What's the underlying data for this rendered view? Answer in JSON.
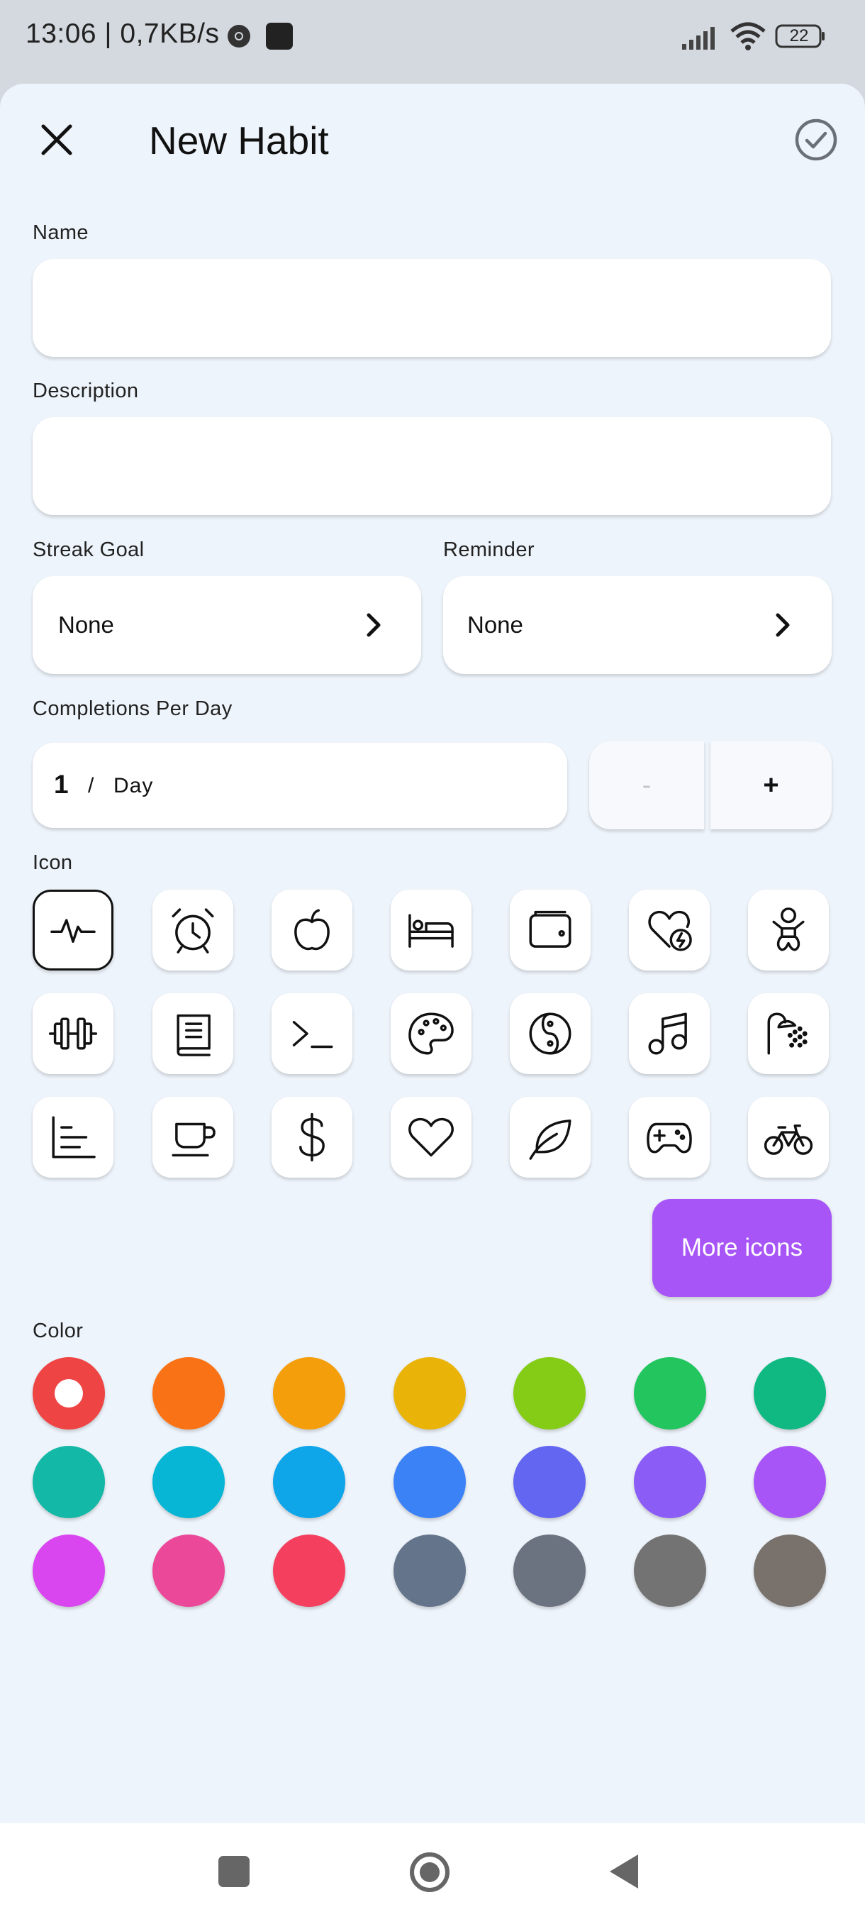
{
  "status_bar": {
    "time_speed": "13:06 | 0,7KB/s",
    "battery": "22"
  },
  "header": {
    "title": "New Habit"
  },
  "form": {
    "name_label": "Name",
    "name_value": "",
    "description_label": "Description",
    "description_value": "",
    "streak_goal_label": "Streak Goal",
    "streak_goal_value": "None",
    "reminder_label": "Reminder",
    "reminder_value": "None",
    "completions_label": "Completions Per Day",
    "completions_value": "1",
    "completions_separator": "/",
    "completions_unit": "Day",
    "decrement_label": "-",
    "increment_label": "+"
  },
  "icons": {
    "label": "Icon",
    "items": [
      "activity-icon",
      "alarm-clock-icon",
      "apple-icon",
      "bed-icon",
      "wallet-icon",
      "heart-bolt-icon",
      "baby-icon",
      "dumbbell-icon",
      "book-icon",
      "terminal-icon",
      "palette-icon",
      "yin-yang-icon",
      "music-icon",
      "shower-icon",
      "chart-icon",
      "coffee-cup-icon",
      "dollar-icon",
      "heart-icon",
      "leaf-icon",
      "gamepad-icon",
      "bicycle-icon"
    ],
    "selected": "activity-icon",
    "more_label": "More icons"
  },
  "colors": {
    "label": "Color",
    "selected": "#ef4444",
    "swatches": [
      "#ef4444",
      "#f97316",
      "#f59e0b",
      "#eab308",
      "#84cc16",
      "#22c55e",
      "#10b981",
      "#14b8a6",
      "#06b6d4",
      "#0ea5e9",
      "#3b82f6",
      "#6366f1",
      "#8b5cf6",
      "#a855f7",
      "#d946ef",
      "#ec4899",
      "#f43f5e",
      "#64748b",
      "#6b7280",
      "#737373",
      "#78716c"
    ]
  },
  "accent": "#a855f7"
}
